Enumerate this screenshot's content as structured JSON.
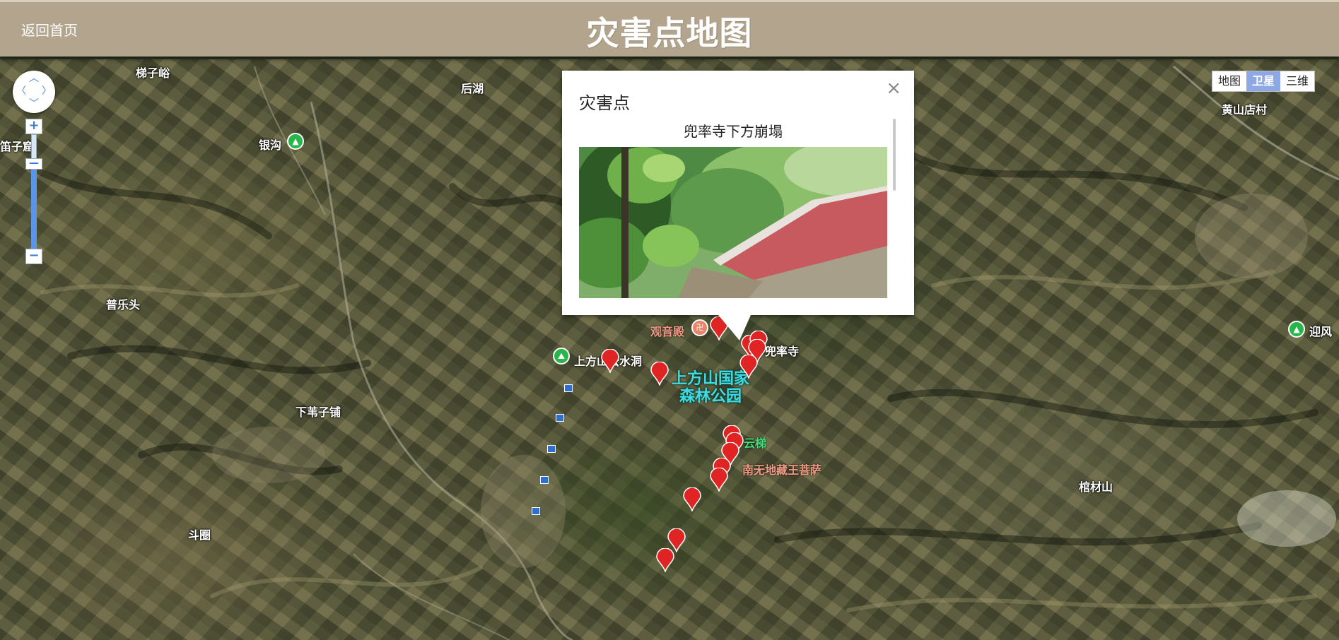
{
  "header": {
    "back_label": "返回首页",
    "title": "灾害点地图"
  },
  "map_types": [
    "地图",
    "卫星",
    "三维"
  ],
  "map_type_selected": "卫星",
  "zoom": {
    "plus": "+",
    "minus": "−",
    "level_fraction": 0.74
  },
  "place_labels": {
    "tizi": "梯子峪",
    "houhu": "后湖",
    "yingou": "银沟",
    "dizi": "笛子窟",
    "pule": "普乐头",
    "xiawei": "下苇子铺",
    "douquan": "斗圈",
    "huangshan": "黄山店村",
    "yingfeng": "迎风",
    "guancai": "棺材山",
    "guanyin": "观音殿",
    "doushuai": "兜率寺",
    "shuidong": "上方山云水洞",
    "park_line1": "上方山国家",
    "park_line2": "森林公园",
    "yunti": "云梯",
    "dizang": "南无地藏王菩萨"
  },
  "info_window": {
    "title": "灾害点",
    "close": "×",
    "caption": "兜率寺下方崩塌"
  },
  "marker_color": "#e02424"
}
